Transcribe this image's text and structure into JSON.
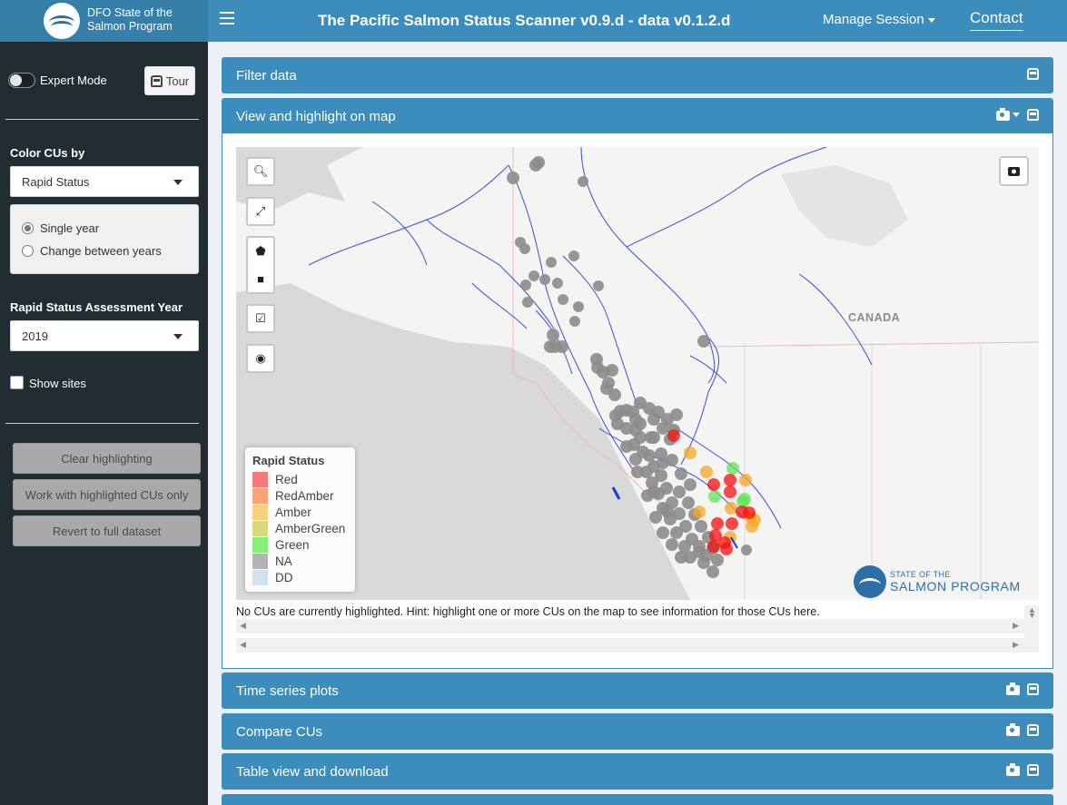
{
  "header": {
    "logo_line1": "DFO State of the",
    "logo_line2": "Salmon Program",
    "title": "The Pacific Salmon Status Scanner v0.9.d - data v0.1.2.d",
    "manage_session": "Manage Session",
    "contact": "Contact"
  },
  "sidebar": {
    "expert_mode_label": "Expert Mode",
    "tour_label": "Tour",
    "color_by_label": "Color CUs by",
    "color_by_value": "Rapid Status",
    "radio_single": "Single year",
    "radio_change": "Change between years",
    "year_label": "Rapid Status Assessment Year",
    "year_value": "2019",
    "show_sites_label": "Show sites",
    "buttons": {
      "clear": "Clear highlighting",
      "work": "Work with highlighted CUs only",
      "revert": "Revert to full dataset"
    }
  },
  "panels": {
    "filter": "Filter data",
    "view": "View and highlight on map",
    "time_series": "Time series plots",
    "compare": "Compare CUs",
    "table": "Table view and download"
  },
  "map": {
    "canada_label": "CANADA",
    "legend_title": "Rapid Status",
    "legend": [
      {
        "label": "Red",
        "color": "#f47a7a"
      },
      {
        "label": "RedAmber",
        "color": "#f6a576"
      },
      {
        "label": "Amber",
        "color": "#f8cf7c"
      },
      {
        "label": "AmberGreen",
        "color": "#d7d97e"
      },
      {
        "label": "Green",
        "color": "#86ef7a"
      },
      {
        "label": "NA",
        "color": "#b3b3b3"
      },
      {
        "label": "DD",
        "color": "#d6dfee"
      }
    ],
    "brand_line1": "STATE OF THE",
    "brand_line2": "SALMON PROGRAM"
  },
  "hint": "No CUs are currently highlighted. Hint: highlight one or more CUs on the map to see information for those CUs here."
}
